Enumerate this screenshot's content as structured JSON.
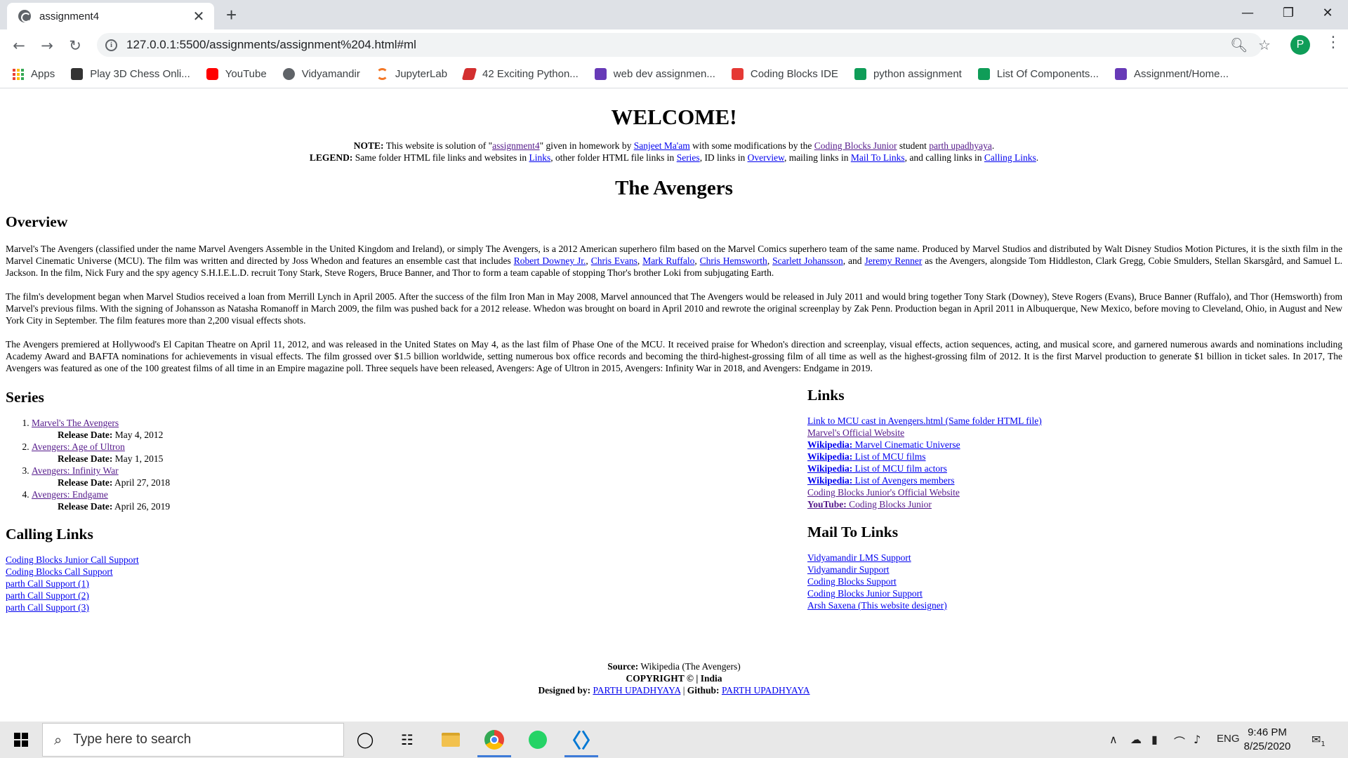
{
  "browser": {
    "tab_title": "assignment4",
    "tab_close": "✕",
    "new_tab": "+",
    "url": "127.0.0.1:5500/assignments/assignment%204.html#ml",
    "profile_initial": "P",
    "bookmarks": [
      {
        "label": "Apps",
        "color": "#ea4335"
      },
      {
        "label": "Play 3D Chess Onli...",
        "color": "#333333"
      },
      {
        "label": "YouTube",
        "color": "#ff0000"
      },
      {
        "label": "Vidyamandir",
        "color": "#5f6368"
      },
      {
        "label": "JupyterLab",
        "color": "#f37726"
      },
      {
        "label": "42 Exciting Python...",
        "color": "#d32f2f"
      },
      {
        "label": "web dev assignmen...",
        "color": "#673ab7"
      },
      {
        "label": "Coding Blocks IDE",
        "color": "#e53935"
      },
      {
        "label": "python assignment",
        "color": "#0f9d58"
      },
      {
        "label": "List Of Components...",
        "color": "#0f9d58"
      },
      {
        "label": "Assignment/Home...",
        "color": "#673ab7"
      }
    ]
  },
  "page": {
    "welcome": "WELCOME!",
    "note": {
      "label": "NOTE:",
      "t1": " This website is solution of \"",
      "assignment_link": "assignment4",
      "t2": "\" given in homework by ",
      "teacher_link": "Sanjeet Ma'am",
      "t3": " with some modifications by the ",
      "cbj_link": "Coding Blocks Junior",
      "t4": " student ",
      "student_link": "parth upadhyaya",
      "t5": "."
    },
    "legend": {
      "label": "LEGEND:",
      "t1": " Same folder HTML file links and websites in ",
      "links": "Links",
      "t2": ", other folder HTML file links in ",
      "series": "Series",
      "t3": ", ID links in ",
      "overview": "Overview",
      "t4": ", mailing links in ",
      "mail": "Mail To Links",
      "t5": ", and calling links in ",
      "calling": "Calling Links",
      "t6": "."
    },
    "title": "The Avengers",
    "overview": {
      "heading": "Overview",
      "p1_a": "Marvel's The Avengers (classified under the name Marvel Avengers Assemble in the United Kingdom and Ireland), or simply The Avengers, is a 2012 American superhero film based on the Marvel Comics superhero team of the same name. Produced by Marvel Studios and distributed by Walt Disney Studios Motion Pictures, it is the sixth film in the Marvel Cinematic Universe (MCU). The film was written and directed by Joss Whedon and features an ensemble cast that includes ",
      "cast": [
        "Robert Downey Jr.",
        "Chris Evans",
        "Mark Ruffalo",
        "Chris Hemsworth",
        "Scarlett Johansson",
        "Jeremy Renner"
      ],
      "sep": ", ",
      "and": ", and ",
      "p1_b": " as the Avengers, alongside Tom Hiddleston, Clark Gregg, Cobie Smulders, Stellan Skarsgård, and Samuel L. Jackson. In the film, Nick Fury and the spy agency S.H.I.E.L.D. recruit Tony Stark, Steve Rogers, Bruce Banner, and Thor to form a team capable of stopping Thor's brother Loki from subjugating Earth.",
      "p2": "The film's development began when Marvel Studios received a loan from Merrill Lynch in April 2005. After the success of the film Iron Man in May 2008, Marvel announced that The Avengers would be released in July 2011 and would bring together Tony Stark (Downey), Steve Rogers (Evans), Bruce Banner (Ruffalo), and Thor (Hemsworth) from Marvel's previous films. With the signing of Johansson as Natasha Romanoff in March 2009, the film was pushed back for a 2012 release. Whedon was brought on board in April 2010 and rewrote the original screenplay by Zak Penn. Production began in April 2011 in Albuquerque, New Mexico, before moving to Cleveland, Ohio, in August and New York City in September. The film features more than 2,200 visual effects shots.",
      "p3": "The Avengers premiered at Hollywood's El Capitan Theatre on April 11, 2012, and was released in the United States on May 4, as the last film of Phase One of the MCU. It received praise for Whedon's direction and screenplay, visual effects, action sequences, acting, and musical score, and garnered numerous awards and nominations including Academy Award and BAFTA nominations for achievements in visual effects. The film grossed over $1.5 billion worldwide, setting numerous box office records and becoming the third-highest-grossing film of all time as well as the highest-grossing film of 2012. It is the first Marvel production to generate $1 billion in ticket sales. In 2017, The Avengers was featured as one of the 100 greatest films of all time in an Empire magazine poll. Three sequels have been released, Avengers: Age of Ultron in 2015, Avengers: Infinity War in 2018, and Avengers: Endgame in 2019."
    },
    "series": {
      "heading": "Series",
      "release_label": "Release Date:",
      "items": [
        {
          "title": "Marvel's The Avengers",
          "date": " May 4, 2012"
        },
        {
          "title": "Avengers: Age of Ultron",
          "date": " May 1, 2015"
        },
        {
          "title": "Avengers: Infinity War",
          "date": " April 27, 2018"
        },
        {
          "title": "Avengers: Endgame",
          "date": " April 26, 2019"
        }
      ]
    },
    "calling": {
      "heading": "Calling Links",
      "items": [
        "Coding Blocks Junior Call Support",
        "Coding Blocks Call Support",
        "parth Call Support (1)",
        "parth Call Support (2)",
        "parth Call Support (3)"
      ]
    },
    "links": {
      "heading": "Links",
      "items": [
        {
          "prefix": "",
          "text": "Link to MCU cast in Avengers.html (Same folder HTML file)"
        },
        {
          "prefix": "",
          "text": "Marvel's Official Website"
        },
        {
          "prefix": "Wikipedia:",
          "text": " Marvel Cinematic Universe"
        },
        {
          "prefix": "Wikipedia:",
          "text": " List of MCU films"
        },
        {
          "prefix": "Wikipedia:",
          "text": " List of MCU film actors"
        },
        {
          "prefix": "Wikipedia:",
          "text": " List of Avengers members"
        },
        {
          "prefix": "",
          "text": "Coding Blocks Junior's Official Website"
        },
        {
          "prefix": "YouTube:",
          "text": " Coding Blocks Junior"
        }
      ]
    },
    "mail": {
      "heading": "Mail To Links",
      "items": [
        "Vidyamandir LMS Support",
        "Vidyamandir Support",
        "Coding Blocks Support",
        "Coding Blocks Junior Support",
        "Arsh Saxena (This website designer)"
      ]
    },
    "footer": {
      "source_label": "Source:",
      "source_text": " Wikipedia (The Avengers)",
      "copyright": "COPYRIGHT © | India",
      "designed_label": "Designed by:",
      "designer_link": "PARTH UPADHYAYA",
      "pipe": " | ",
      "github_label": "Github:",
      "github_link": "PARTH UPADHYAYA"
    }
  },
  "taskbar": {
    "search_placeholder": "Type here to search",
    "language": "ENG",
    "time": "9:46 PM",
    "date": "8/25/2020",
    "notification_count": "1"
  }
}
